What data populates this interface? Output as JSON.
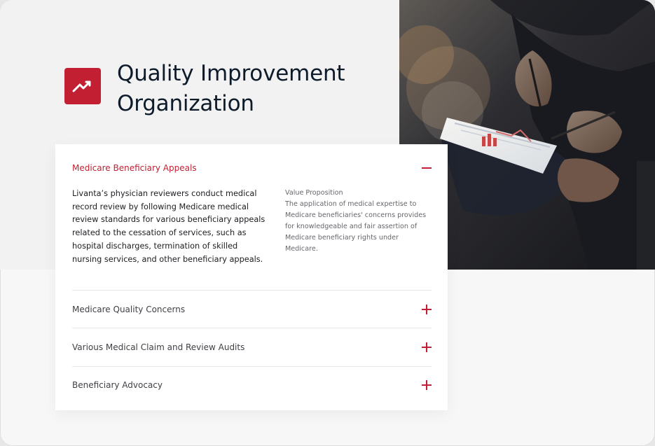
{
  "hero": {
    "title": "Quality Improvement Organization",
    "accent_color": "#c21f32",
    "icon": "trend-up-icon"
  },
  "accordion": {
    "items": [
      {
        "title": "Medicare Beneficiary Appeals",
        "state": "expanded",
        "body": "Livanta’s physician reviewers conduct medical record review by following Medicare medical review standards for various beneficiary appeals related to the cessation of services, such as hospital discharges, termination of skilled nursing services, and other beneficiary appeals.",
        "value_label": "Value Proposition",
        "value_text": "The application of medical expertise to Medicare beneficiaries' concerns provides for knowledgeable and fair assertion of Medicare beneficiary rights under Medicare."
      },
      {
        "title": "Medicare Quality Concerns",
        "state": "collapsed"
      },
      {
        "title": "Various Medical Claim and Review Audits",
        "state": "collapsed"
      },
      {
        "title": "Beneficiary Advocacy",
        "state": "collapsed"
      }
    ],
    "icons": {
      "expanded": "minus-icon",
      "collapsed": "plus-icon"
    }
  }
}
